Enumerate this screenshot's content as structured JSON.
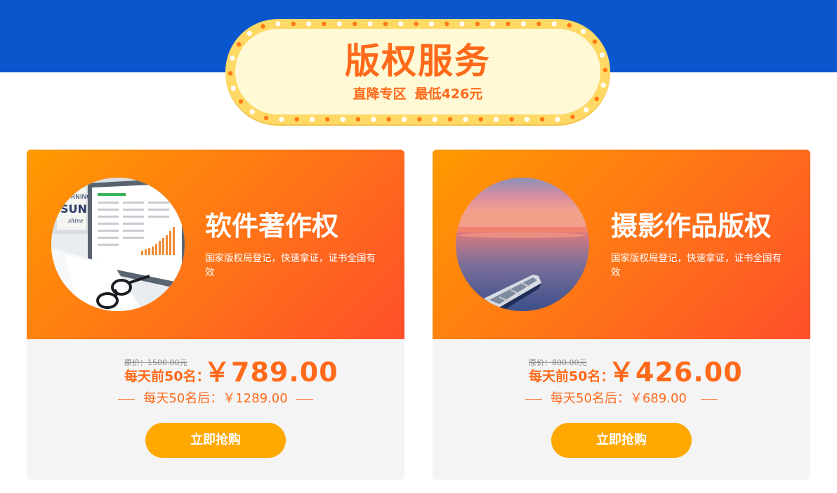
{
  "banner": {
    "title": "版权服务",
    "sub_left": "直降专区",
    "sub_right": "最低426元"
  },
  "cards": [
    {
      "title": "软件著作权",
      "description": "国家版权局登记，快速拿证，证书全国有效",
      "original_price": "原价：1500.00元",
      "promo_label": "每天前50名：",
      "promo_price": "￥789.00",
      "later_price": "每天50名后：￥1289.00",
      "button_label": "立即抢购",
      "image_icon": "laptop-analytics-photo"
    },
    {
      "title": "摄影作品版权",
      "description": "国家版权局登记，快速拿证，证书全国有效",
      "original_price": "原价：800.00元",
      "promo_label": "每天前50名：",
      "promo_price": "￥426.00",
      "later_price": "每天50名后：￥689.00",
      "button_label": "立即抢购",
      "image_icon": "sunset-boat-photo"
    }
  ],
  "colors": {
    "header_blue": "#0a56cd",
    "accent_orange": "#ff6a1a",
    "button_yellow": "#ffa800",
    "badge_yellow": "#ffd966"
  }
}
